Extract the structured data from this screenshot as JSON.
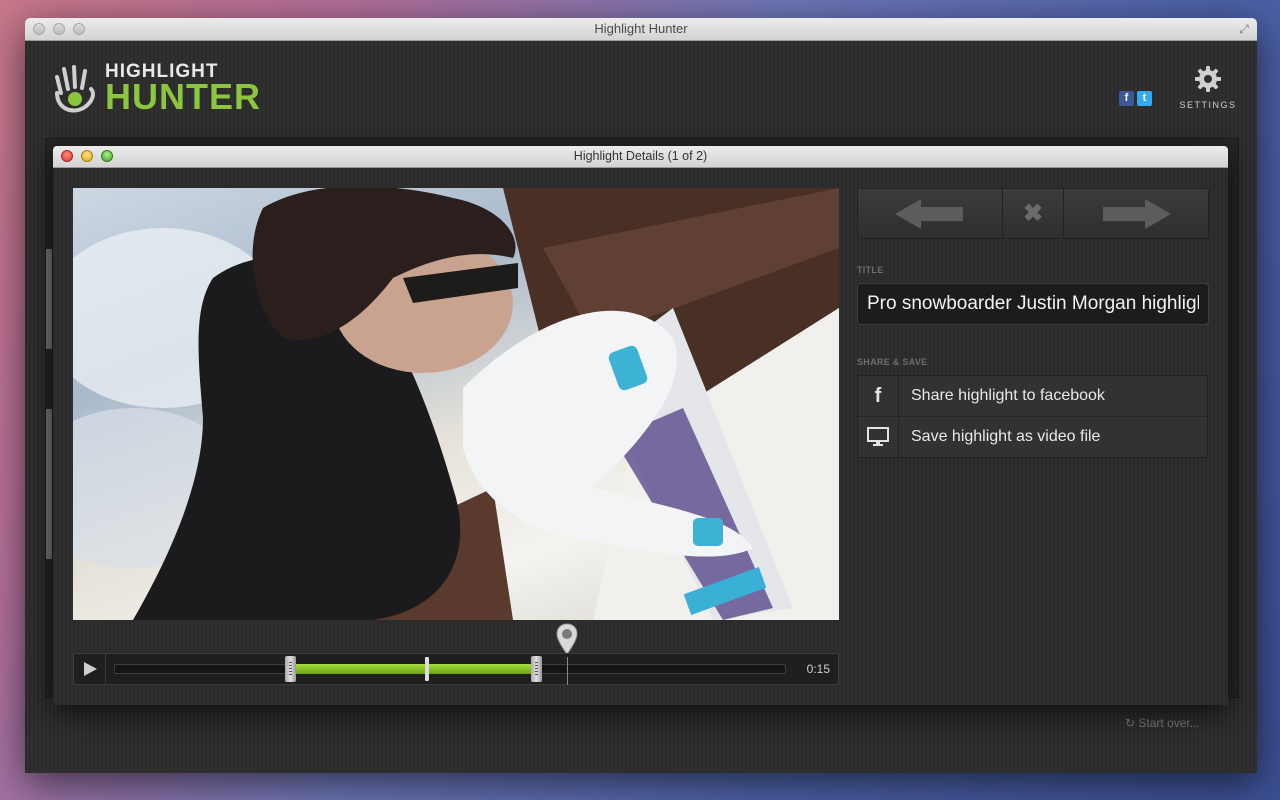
{
  "window": {
    "title": "Highlight Hunter"
  },
  "logo": {
    "line1": "HIGHLIGHT",
    "line2": "HUNTER"
  },
  "header": {
    "facebook_glyph": "f",
    "twitter_glyph": "t",
    "settings_label": "SETTINGS"
  },
  "footer": {
    "start_over_label": "Start over..."
  },
  "dialog": {
    "title": "Highlight Details (1 of 2)",
    "title_section_label": "TITLE",
    "title_value": "Pro snowboarder Justin Morgan highlight",
    "share_section_label": "SHARE & SAVE",
    "share_items": [
      {
        "label": "Share highlight to facebook",
        "icon": "facebook-icon"
      },
      {
        "label": "Save highlight as video file",
        "icon": "monitor-icon"
      }
    ],
    "nav": {
      "prev_icon": "arrow-left-icon",
      "close_icon": "close-icon",
      "next_icon": "arrow-right-icon"
    }
  },
  "timeline": {
    "time_label": "0:15",
    "selection_start_fraction": 0.262,
    "selection_end_fraction": 0.627,
    "mid_marker_fraction": 0.465,
    "playhead_fraction": 0.673
  },
  "colors": {
    "accent": "#8cc63f",
    "facebook": "#3b5998",
    "twitter": "#33aaf0"
  }
}
